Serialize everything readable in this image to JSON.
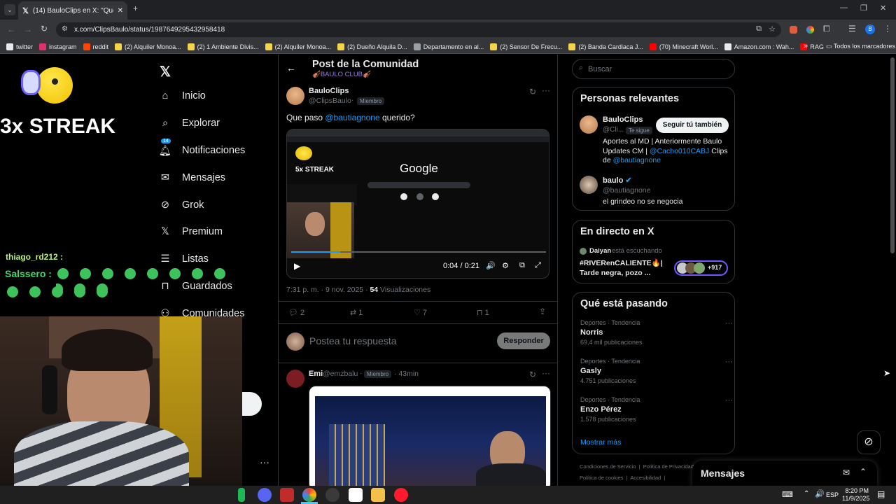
{
  "browser": {
    "tab_title": "(14) BauloClips en X: \"Que paso",
    "url": "x.com/ClipsBaulo/status/1987649295432958418",
    "bookmarks": [
      {
        "label": "twitter",
        "color": "#e7e9ea"
      },
      {
        "label": "instagram",
        "color": "#e1306c"
      },
      {
        "label": "reddit",
        "color": "#ff4500"
      },
      {
        "label": "(2) Alquiler Monoa...",
        "color": "#f5d547"
      },
      {
        "label": "(2) 1 Ambiente Divis...",
        "color": "#f5d547"
      },
      {
        "label": "(2) Alquiler Monoa...",
        "color": "#f5d547"
      },
      {
        "label": "(2) Dueño Alquila D...",
        "color": "#f5d547"
      },
      {
        "label": "Departamento en al...",
        "color": "#9aa0a6"
      },
      {
        "label": "(2) Sensor De Frecu...",
        "color": "#f5d547"
      },
      {
        "label": "(2) Banda Cardiaca J...",
        "color": "#f5d547"
      },
      {
        "label": "(70) Minecraft Worl...",
        "color": "#ff0000"
      },
      {
        "label": "Amazon.com : Wah...",
        "color": "#e7e9ea"
      },
      {
        "label": "RAG",
        "color": "#ff0000"
      }
    ],
    "bookmarks_more": "»",
    "all_bookmarks": "Todos los marcadores"
  },
  "stream_overlay": {
    "streak": "3x STREAK",
    "chat_user": "thiago_rd212 :",
    "chat_name": "Salssero :"
  },
  "nav": {
    "items": [
      {
        "label": "Inicio",
        "icon": "home-icon"
      },
      {
        "label": "Explorar",
        "icon": "search-icon"
      },
      {
        "label": "Notificaciones",
        "icon": "bell-icon",
        "badge": "14"
      },
      {
        "label": "Mensajes",
        "icon": "mail-icon"
      },
      {
        "label": "Grok",
        "icon": "grok-icon"
      },
      {
        "label": "Premium",
        "icon": "x-logo-icon"
      },
      {
        "label": "Listas",
        "icon": "list-icon"
      },
      {
        "label": "Guardados",
        "icon": "bookmark-icon"
      },
      {
        "label": "Comunidades",
        "icon": "community-icon"
      }
    ],
    "more": "···"
  },
  "post_header": {
    "title": "Post de la Comunidad",
    "community": "🎻BAULO CLUB🎻"
  },
  "post": {
    "author": "BauloClips",
    "handle": "@ClipsBaulo",
    "role": "Miembro",
    "text_prefix": "Que paso ",
    "mention": "@bautiagnone",
    "text_suffix": " querido?",
    "video_time": "0:04 / 0:21",
    "video_inner": {
      "streak": "5x STREAK",
      "search_logo": "Google"
    },
    "timestamp": "7:31 p. m. · 9 nov. 2025 · ",
    "views_count": "54",
    "views_label": " Visualizaciones",
    "stats": {
      "replies": "2",
      "reposts": "1",
      "likes": "7",
      "bookmarks": "1"
    },
    "reply_placeholder": "Postea tu respuesta",
    "reply_button": "Responder"
  },
  "reply": {
    "author": "Emi",
    "handle": "@emzbalu",
    "role": "Miembro",
    "time": "· 43min"
  },
  "sidebar": {
    "search_placeholder": "Buscar",
    "relevant": {
      "title": "Personas relevantes",
      "people": [
        {
          "name": "BauloClips",
          "handle": "@Cli...",
          "tag": "Te sigue",
          "button": "Seguir tú también",
          "bio_1": "Aportes al MD | Anteriormente Baulo Updates CM | ",
          "bio_mention": "@Cacho010CABJ",
          "bio_2": " Clips de ",
          "bio_mention2": "@bautiagnone"
        },
        {
          "name": "baulo",
          "handle": "@bautiagnone",
          "bio": "el grindeo no se negocia"
        }
      ]
    },
    "live": {
      "title": "En directo en X",
      "host": "Daiyan",
      "status": "está escuchando",
      "topic": "#RIVERenCALIENTE🔥| Tarde negra, pozo ...",
      "count": "+917"
    },
    "trending": {
      "title": "Qué está pasando",
      "items": [
        {
          "meta": "Deportes · Tendencia",
          "name": "Norris",
          "count": "69,4 mil publicaciones"
        },
        {
          "meta": "Deportes · Tendencia",
          "name": "Gasly",
          "count": "4.751 publicaciones"
        },
        {
          "meta": "Deportes · Tendencia",
          "name": "Enzo Pérez",
          "count": "1.578 publicaciones"
        }
      ],
      "more": "Mostrar más"
    },
    "footer": {
      "terms": "Condiciones de Servicio",
      "privacy": "Política de Privacidad",
      "cookies": "Política de cookies",
      "access": "Accesibilidad"
    },
    "messages": "Mensajes"
  },
  "taskbar": {
    "lang": "ESP",
    "time": "8:20 PM",
    "date": "11/9/2025"
  }
}
